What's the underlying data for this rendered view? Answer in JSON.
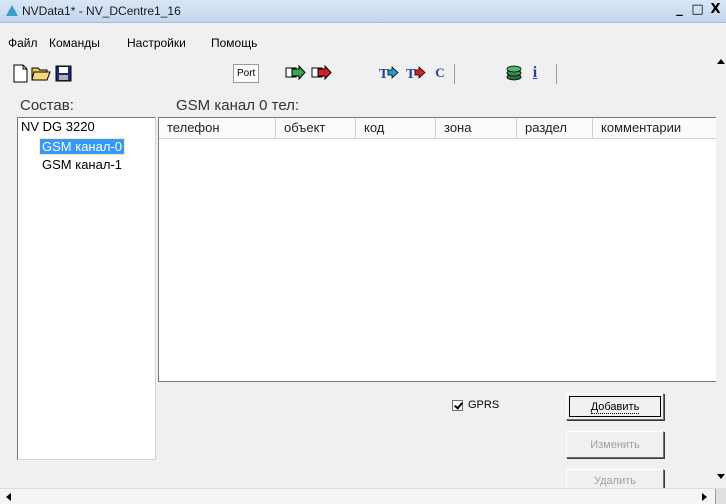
{
  "window": {
    "title": "NVData1* - NV_DCentre1_16",
    "controls": {
      "minimize": "_",
      "maximize": "□",
      "close": "X"
    }
  },
  "menu": {
    "items": [
      "Файл",
      "Команды",
      "Настройки",
      "Помощь"
    ]
  },
  "toolbar": {
    "port_label": "Port",
    "t_label": "T",
    "c_label": "C",
    "info_label": "i"
  },
  "tree": {
    "label": "Состав:",
    "root": "NV DG 3220",
    "children": [
      {
        "label": "GSM канал-0",
        "selected": true
      },
      {
        "label": "GSM канал-1",
        "selected": false
      }
    ]
  },
  "table": {
    "title": "GSM канал 0 тел:",
    "columns": [
      "телефон",
      "объект",
      "код",
      "зона",
      "раздел",
      "комментарии"
    ],
    "rows": []
  },
  "controls": {
    "gprs": {
      "label": "GPRS",
      "checked": true
    },
    "add_label": "Добавить",
    "edit_label": "Изменить",
    "delete_label": "Удалить"
  },
  "colors": {
    "selection": "#3399ff",
    "title_gradient_top": "#d9e6f5",
    "title_gradient_bottom": "#c4d6ee",
    "disabled_text": "#a0a0a0"
  }
}
